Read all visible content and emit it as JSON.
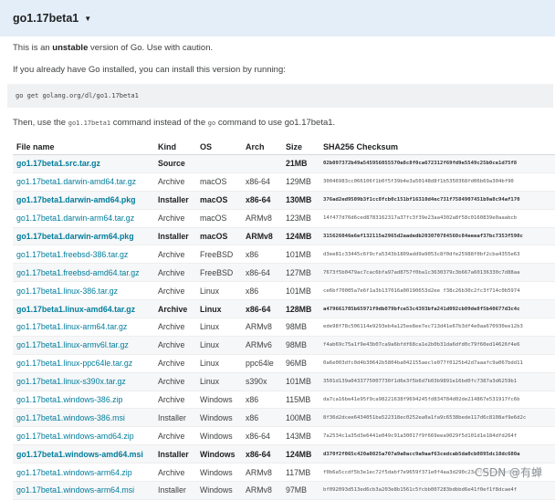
{
  "header": {
    "title": "go1.17beta1",
    "caret": "▼"
  },
  "intro": {
    "line1_pre": "This is an ",
    "line1_bold": "unstable",
    "line1_post": " version of Go. Use with caution.",
    "line2": "If you already have Go installed, you can install this version by running:",
    "command": "go get golang.org/dl/go1.17beta1",
    "line3_pre": "Then, use the ",
    "line3_code1": "go1.17beta1",
    "line3_mid": " command instead of the ",
    "line3_code2": "go",
    "line3_post": " command to use go1.17beta1."
  },
  "table": {
    "headers": [
      "File name",
      "Kind",
      "OS",
      "Arch",
      "Size",
      "SHA256 Checksum"
    ],
    "rows": [
      [
        "go1.17beta1.src.tar.gz",
        "Source",
        "",
        "",
        "21MB",
        "02b097372b49a545956055570e8c8f0ca672312f69fd9e5549c25b0ce1d75f8"
      ],
      [
        "go1.17beta1.darwin-amd64.tar.gz",
        "Archive",
        "macOS",
        "x86-64",
        "129MB",
        "30046983cc066106f1b0f5f39b4e3a50148d8f1b5350368fd06b69a304bf90"
      ],
      [
        "go1.17beta1.darwin-amd64.pkg",
        "Installer",
        "macOS",
        "x86-64",
        "130MB",
        "376ad2ed9509b3f1cc8fcb0c151bf16310d4ec731f7584907451b9a8c94af170"
      ],
      [
        "go1.17beta1.darwin-arm64.tar.gz",
        "Archive",
        "macOS",
        "ARMv8",
        "123MB",
        "14f477d76d6ced8783162317a37fc3f39e23aa4302a8f58c0160839e0aaabcb"
      ],
      [
        "go1.17beta1.darwin-arm64.pkg",
        "Installer",
        "macOS",
        "ARMv8",
        "124MB",
        "315626046e6ef132115e2965d2aadedb203070784560c84eeeaf37bc7353f590c"
      ],
      [
        "go1.17beta1.freebsd-386.tar.gz",
        "Archive",
        "FreeBSD",
        "x86",
        "101MB",
        "d3ee81c33445c6f9cfa5343b1809add9a9053c8f0dfe25988f0bf2cba4355e63"
      ],
      [
        "go1.17beta1.freebsd-amd64.tar.gz",
        "Archive",
        "FreeBSD",
        "x86-64",
        "127MB",
        "7673f5b0479ac7cac6bfa97ad8757f0ba1c3630379c3b667a60136330c7d88aa"
      ],
      [
        "go1.17beta1.linux-386.tar.gz",
        "Archive",
        "Linux",
        "x86",
        "101MB",
        "ce6bf70005a7e6f1a3b137016a00190653d2ee f38c26b30c2fc3f714c0b5974"
      ],
      [
        "go1.17beta1.linux-amd64.tar.gz",
        "Archive",
        "Linux",
        "x86-64",
        "128MB",
        "a479661705b65971f9db079bfce53c4393bfa241d092cb09de8f5b40677d3c4c"
      ],
      [
        "go1.17beta1.linux-arm64.tar.gz",
        "Archive",
        "Linux",
        "ARMv8",
        "98MB",
        "ede98f78c506114e9293eb4a125ee8ee7ec713d41e67b3df4e0aa670930ee12b3"
      ],
      [
        "go1.17beta1.linux-armv6l.tar.gz",
        "Archive",
        "Linux",
        "ARMv6",
        "98MB",
        "f4ab69c75a1f9e43b07ca9a6bfdf68ca1e2b0b31da6dfd0c79f60ed14626f4e6"
      ],
      [
        "go1.17beta1.linux-ppc64le.tar.gz",
        "Archive",
        "Linux",
        "ppc64le",
        "96MB",
        "0a6e003dfc0d4b30642b5804ba042155aecle077f0125b42d7aaafc9a067bdd11"
      ],
      [
        "go1.17beta1.linux-s390x.tar.gz",
        "Archive",
        "Linux",
        "s390x",
        "101MB",
        "3501d139a0433775007730f1d6e3f5b6d7b03b9891e16bd0fc7387a3d6259b1"
      ],
      [
        "go1.17beta1.windows-386.zip",
        "Archive",
        "Windows",
        "x86",
        "115MB",
        "da7ca16be41e95f9ca98221638f9694245fd834784d02de214867e531917fc6b"
      ],
      [
        "go1.17beta1.windows-386.msi",
        "Installer",
        "Windows",
        "x86",
        "100MB",
        "8f36d2dcee6434051ba522318ec0252ea0a1fa9c6538bede117d6c8108af9e6d2c"
      ],
      [
        "go1.17beta1.windows-amd64.zip",
        "Archive",
        "Windows",
        "x86-64",
        "143MB",
        "7a2534c1a35d3e6441e049c91a30017f9f669eea9029f5d101d1e184dfd264f"
      ],
      [
        "go1.17beta1.windows-amd64.msi",
        "Installer",
        "Windows",
        "x86-64",
        "124MB",
        "d370f2f065c420a0825a707a9a0acc9a9aaf63cedcab5da0cb0895dc18dc680a"
      ],
      [
        "go1.17beta1.windows-arm64.zip",
        "Archive",
        "Windows",
        "ARMv8",
        "117MB",
        "f0b6a5ccdf5b3e1ec72f5dabf7e9659f371e0f4aa3d290c23af6665eee7e09e0"
      ],
      [
        "go1.17beta1.windows-arm64.msi",
        "Installer",
        "Windows",
        "ARMv8",
        "97MB",
        "bf092093d513ed6cb3a203e8b1561c5fcbb007283bdbbd6e41f0ef1f8dcae4f"
      ]
    ]
  },
  "watermark": "CSDN @有蝉",
  "colors": {
    "header_bg": "#e4eef8",
    "link": "#007d9c",
    "code_bg": "#f0f1f2"
  }
}
